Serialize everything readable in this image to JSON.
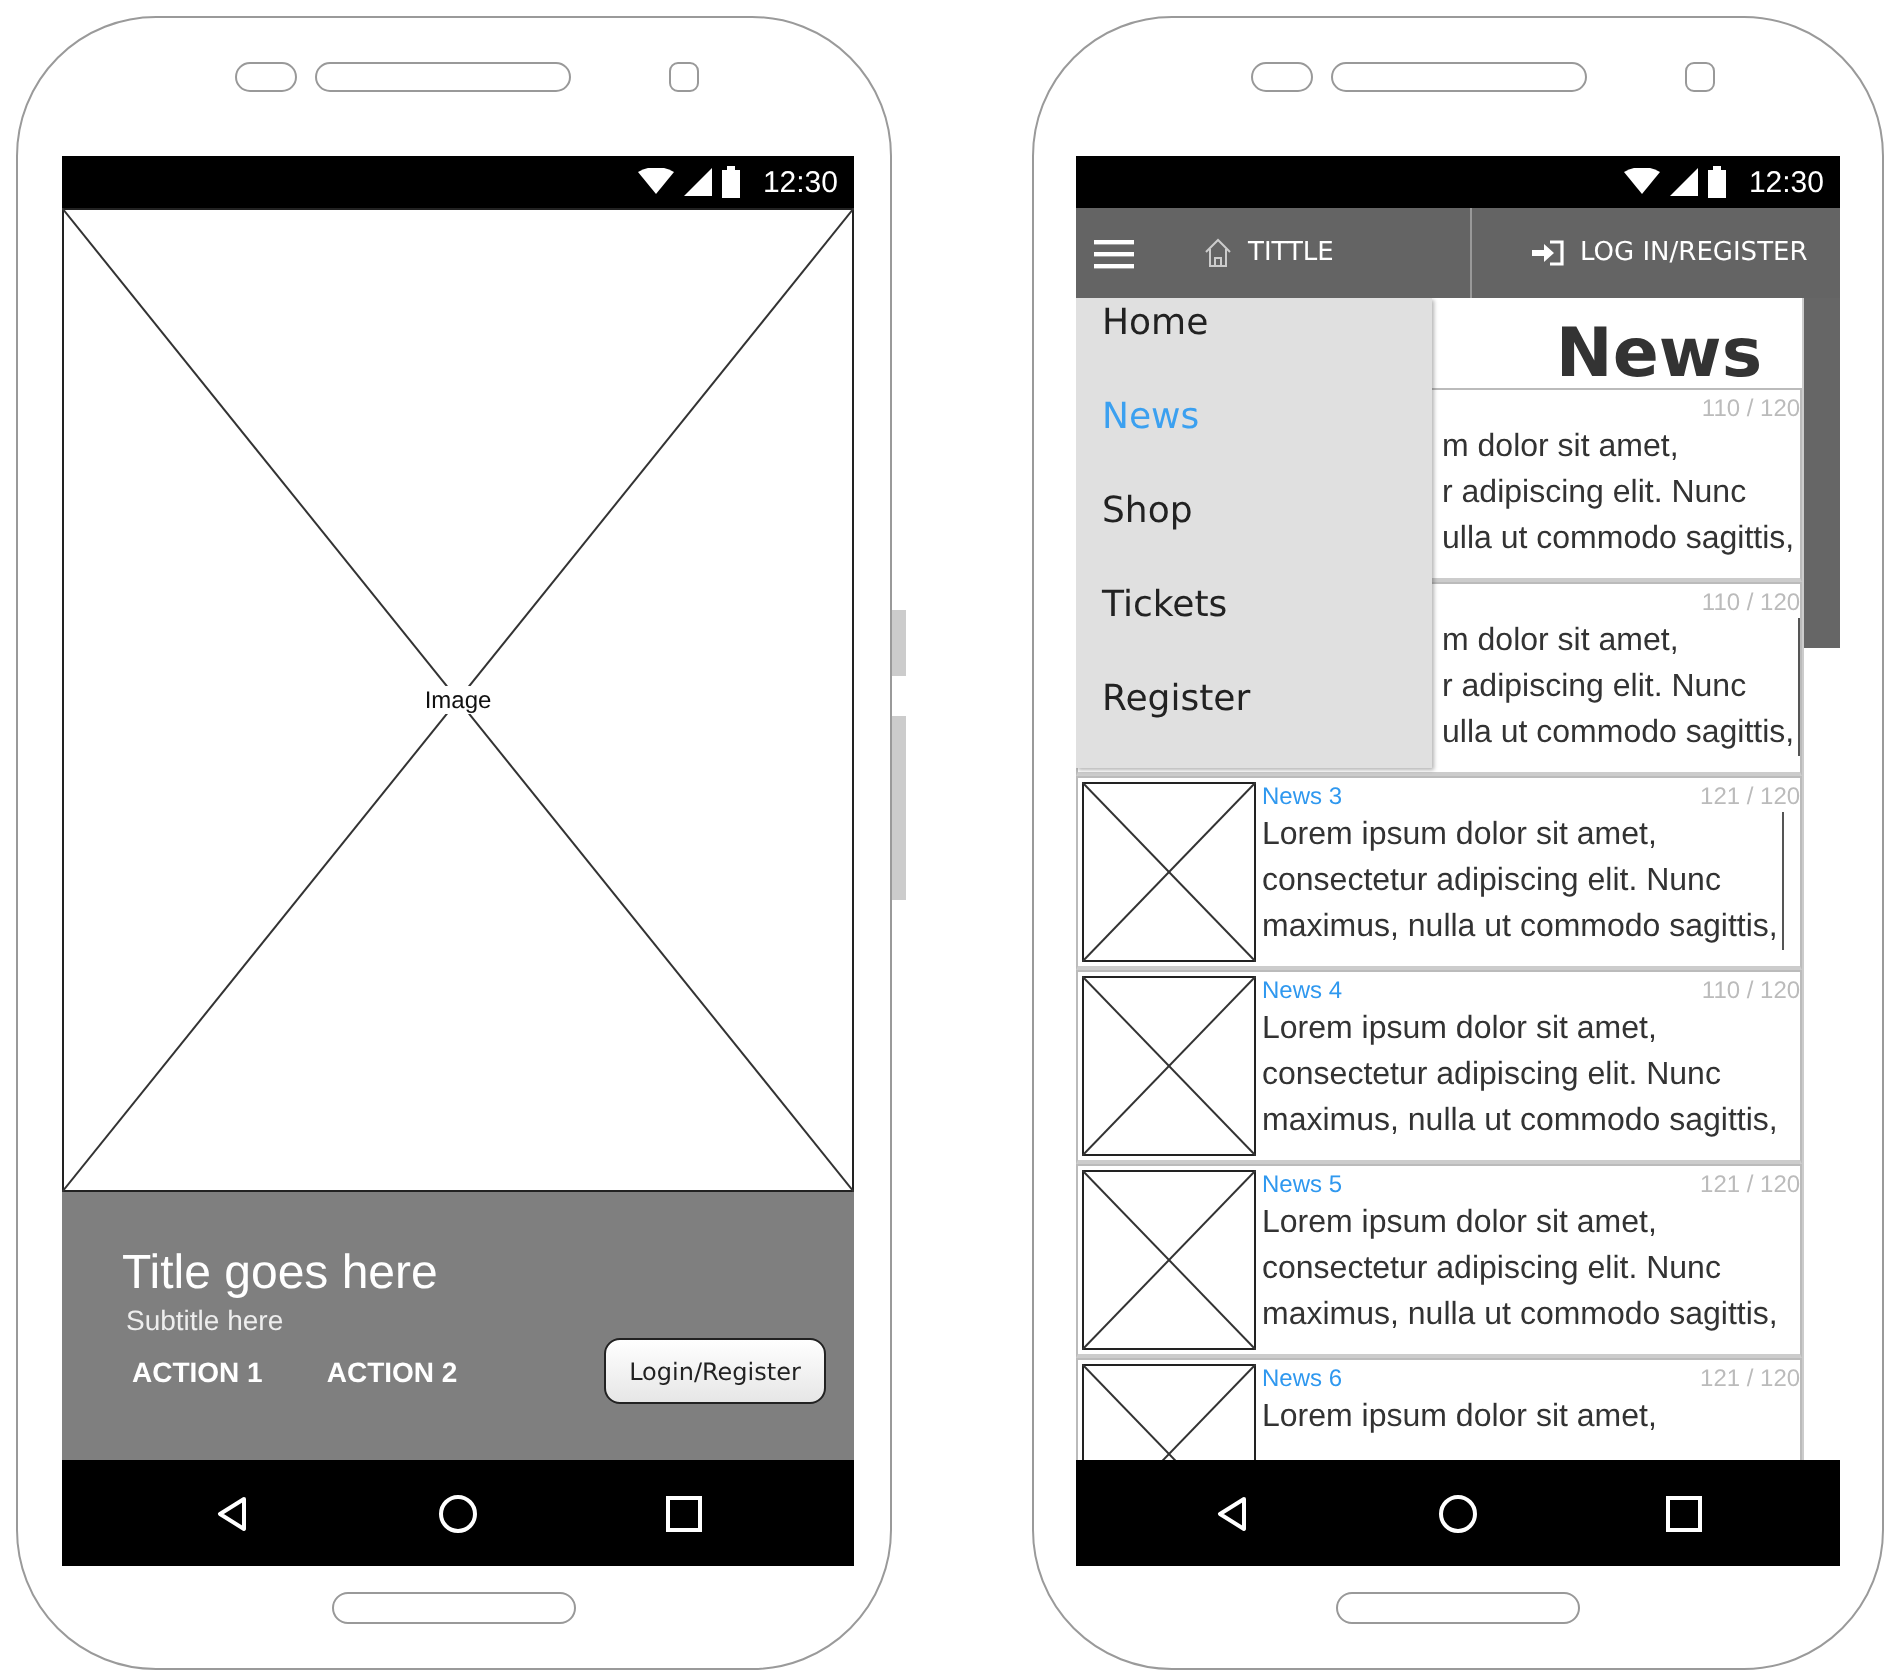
{
  "left_phone": {
    "status_bar": {
      "time": "12:30"
    },
    "image": {
      "label": "Image"
    },
    "card": {
      "title": "Title goes here",
      "subtitle": "Subtitle here",
      "actions": [
        {
          "label": "ACTION 1"
        },
        {
          "label": "ACTION 2"
        }
      ],
      "button": "Login/Register"
    }
  },
  "right_phone": {
    "status_bar": {
      "time": "12:30"
    },
    "app_bar": {
      "title": "TITTLE",
      "login": "LOG IN/REGISTER"
    },
    "heading": "News",
    "menu": {
      "items": [
        {
          "label": "Home",
          "selected": false
        },
        {
          "label": "News",
          "selected": true
        },
        {
          "label": "Shop",
          "selected": false
        },
        {
          "label": "Tickets",
          "selected": false
        },
        {
          "label": "Register",
          "selected": false
        }
      ]
    },
    "news": [
      {
        "kind": "covered",
        "count": "110 / 120",
        "lines": [
          "m dolor sit amet,",
          "r adipiscing elit. Nunc",
          "ulla ut commodo sagittis,"
        ],
        "focused": false
      },
      {
        "kind": "covered",
        "count": "110 / 120",
        "lines": [
          "m dolor sit amet,",
          "r adipiscing elit. Nunc",
          "ulla ut commodo sagittis,"
        ],
        "focused": true
      },
      {
        "kind": "full",
        "title": "News 3",
        "count": "121 / 120",
        "lines": [
          "Lorem ipsum dolor sit amet,",
          "consectetur adipiscing elit. Nunc",
          "maximus, nulla ut commodo sagittis,"
        ],
        "focused": true
      },
      {
        "kind": "full",
        "title": "News 4",
        "count": "110 / 120",
        "lines": [
          "Lorem ipsum dolor sit amet,",
          "consectetur adipiscing elit. Nunc",
          "maximus, nulla ut commodo sagittis,"
        ],
        "focused": false
      },
      {
        "kind": "full",
        "title": "News 5",
        "count": "121 / 120",
        "lines": [
          "Lorem ipsum dolor sit amet,",
          "consectetur adipiscing elit. Nunc",
          "maximus, nulla ut commodo sagittis,"
        ],
        "focused": false
      },
      {
        "kind": "full",
        "title": "News 6",
        "count": "121 / 120",
        "lines": [
          "Lorem ipsum dolor sit amet,"
        ],
        "focused": false
      }
    ]
  }
}
